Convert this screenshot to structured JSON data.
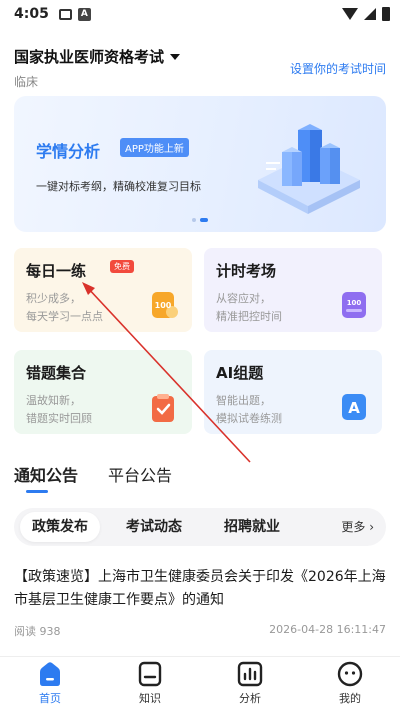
{
  "status_bar": {
    "time": "4:05",
    "notif_a": "A"
  },
  "header": {
    "exam_title": "国家执业医师资格考试",
    "exam_subject": "临床",
    "set_time_link": "设置你的考试时间"
  },
  "banner": {
    "title": "学情分析",
    "badge": "APP功能上新",
    "description": "一键对标考纲，精确校准复习目标"
  },
  "cards": [
    {
      "title": "每日一练",
      "badge": "免费",
      "line1": "积少成多，",
      "line2": "每天学习一点点",
      "icon": "100"
    },
    {
      "title": "计时考场",
      "line1": "从容应对，",
      "line2": "精准把控时间",
      "icon": "100"
    },
    {
      "title": "错题集合",
      "line1": "温故知新，",
      "line2": "错题实时回顾",
      "icon": "check-icon"
    },
    {
      "title": "AI组题",
      "line1": "智能出题，",
      "line2": "模拟试卷练测",
      "icon": "A"
    }
  ],
  "notice_tabs": [
    "通知公告",
    "平台公告"
  ],
  "categories": [
    "政策发布",
    "考试动态",
    "招聘就业"
  ],
  "more_label": "更多",
  "article": {
    "title": "【政策速览】上海市卫生健康委员会关于印发《2026年上海市基层卫生健康工作要点》的通知",
    "reads": "阅读 938",
    "date": "2026-04-28 16:11:47"
  },
  "bottom_nav": [
    {
      "label": "首页",
      "icon": "home-icon"
    },
    {
      "label": "知识",
      "icon": "knowledge-icon"
    },
    {
      "label": "分析",
      "icon": "analysis-icon"
    },
    {
      "label": "我的",
      "icon": "profile-icon"
    }
  ],
  "colors": {
    "accent": "#2d7bf0",
    "annotation": "#d9322b",
    "free_badge": "#f24a3d"
  }
}
